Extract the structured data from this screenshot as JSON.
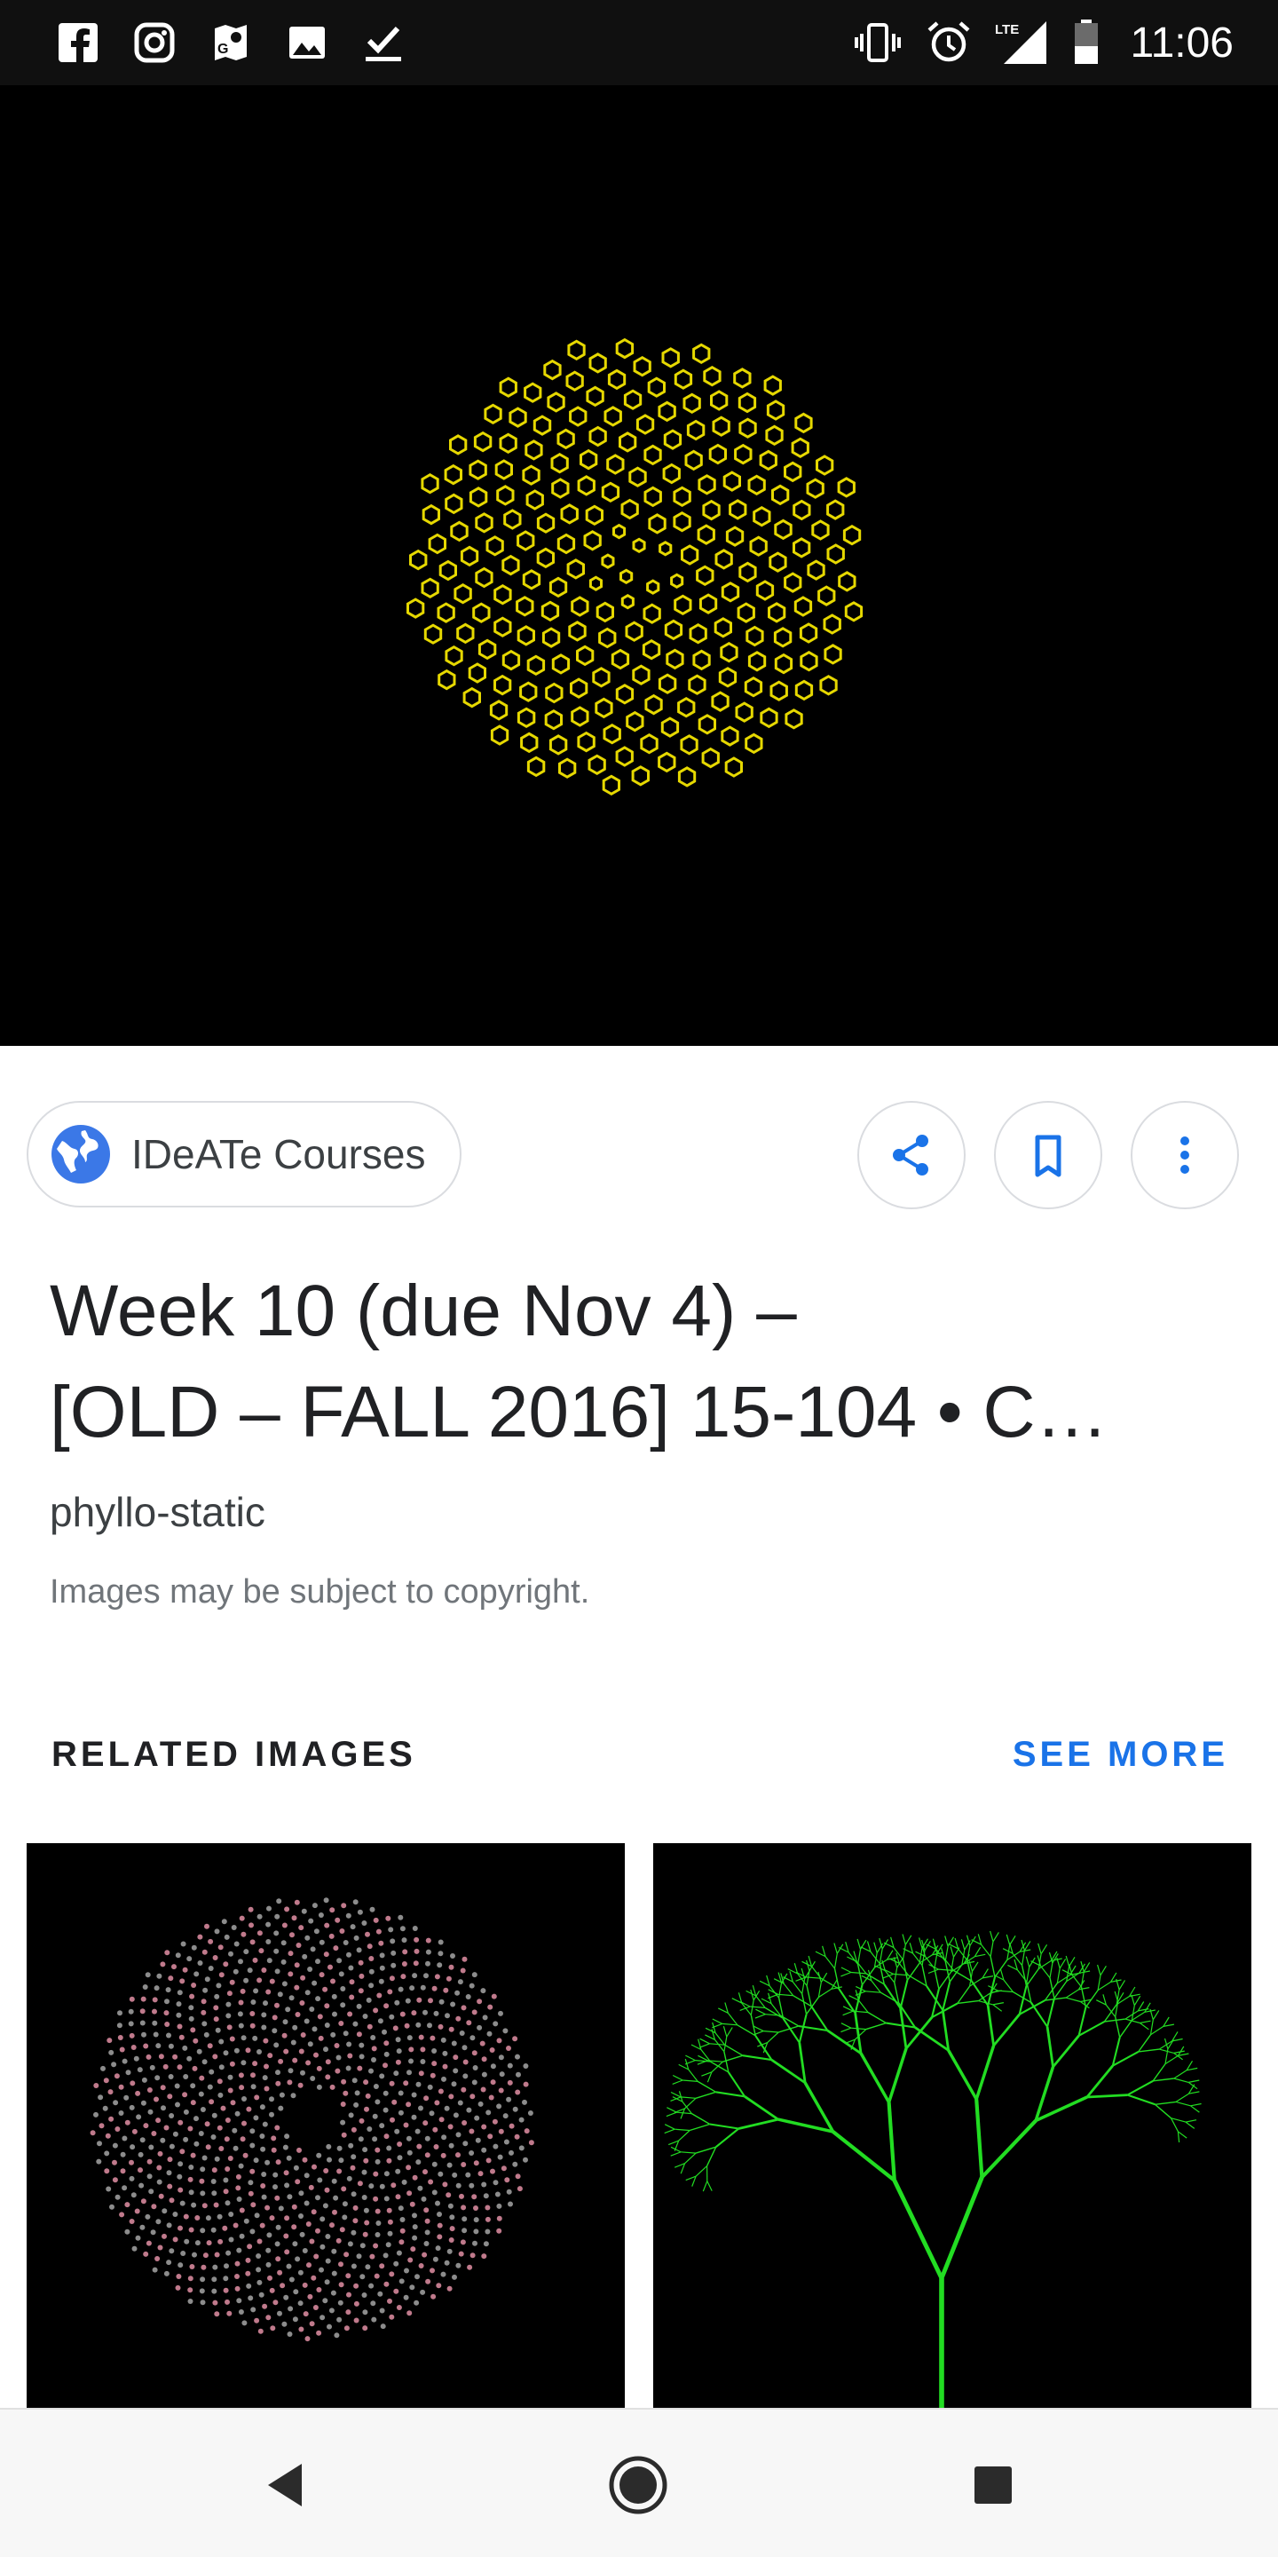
{
  "status_bar": {
    "left_icons": [
      "facebook-icon",
      "instagram-icon",
      "maps-icon",
      "image-icon",
      "checkmark-icon"
    ],
    "right_icons": [
      "vibrate-icon",
      "alarm-icon",
      "lte-signal-icon",
      "battery-icon"
    ],
    "network": "LTE",
    "time": "11:06"
  },
  "hero": {
    "description_icon": "phyllotaxis-image",
    "background": "#000000",
    "dot_color": "#e6d800"
  },
  "source": {
    "label": "IDeATe Courses",
    "icon": "globe-icon"
  },
  "actions": {
    "share": "share-icon",
    "bookmark": "bookmark-icon",
    "more": "more-vert-icon"
  },
  "result": {
    "title_line1": "Week 10 (due Nov 4) –",
    "title_line2": "[OLD – FALL 2016] 15-104 • C…",
    "subtitle": "phyllo-static",
    "copyright": "Images may be subject to copyright."
  },
  "related": {
    "heading": "RELATED IMAGES",
    "see_more": "SEE MORE",
    "thumbnails": [
      "spiral-dots-image",
      "fractal-tree-image"
    ]
  },
  "navbar": {
    "back": "back-icon",
    "home": "home-icon",
    "recents": "recents-icon"
  },
  "colors": {
    "accent": "#1a73e8",
    "status_bar": "#101010",
    "tree_green": "#22dd22"
  }
}
